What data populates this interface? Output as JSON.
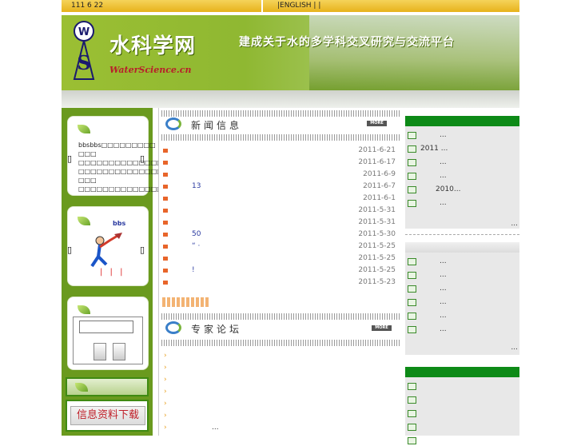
{
  "topbar": {
    "date": "111 6 22",
    "lang_links": "|ENGLISH |   |"
  },
  "banner": {
    "title": "水科学网",
    "subtitle": "WaterScience.cn",
    "slogan": "建成关于水的多学科交叉研究与交流平台",
    "logo_letters": {
      "top": "W",
      "bottom": "S"
    }
  },
  "left": {
    "box1_lines": [
      "bbsbbs□□□□□□□□□",
      "□□□",
      "□□□□□□□□□□□□□□",
      "□□□□□□□□□□□□□□",
      "□□□",
      "□□□□□□□□□□□□□□"
    ],
    "box2_title": "bbs",
    "box2_bars": "| | |",
    "download_label": "信息资料下载"
  },
  "news": {
    "title": "新闻信息",
    "more": "MORE",
    "items": [
      {
        "text": "",
        "date": "2011-6-21"
      },
      {
        "text": "",
        "date": "2011-6-17"
      },
      {
        "text": "",
        "date": "2011-6-9"
      },
      {
        "text": "13",
        "date": "2011-6-7"
      },
      {
        "text": "",
        "date": "2011-6-1"
      },
      {
        "text": "",
        "date": "2011-5-31"
      },
      {
        "text": "",
        "date": "2011-5-31"
      },
      {
        "text": "50",
        "date": "2011-5-30"
      },
      {
        "text": "“  ·",
        "date": "2011-5-25"
      },
      {
        "text": "",
        "date": "2011-5-25"
      },
      {
        "text": "!",
        "date": "2011-5-25"
      },
      {
        "text": "",
        "date": "2011-5-23"
      }
    ]
  },
  "forum": {
    "title": "专家论坛",
    "more": "MORE",
    "items": [
      "",
      "",
      "",
      "",
      "",
      "",
      "..."
    ]
  },
  "right": {
    "panel1_items": [
      "...",
      "2011     ...",
      "...",
      "...",
      "2010...",
      "..."
    ],
    "panel1_more": "...",
    "panel2_items": [
      "...",
      "...",
      "...",
      "...",
      "...",
      "..."
    ],
    "panel2_more": "...",
    "panel3_items": [
      "",
      "",
      "",
      "",
      ""
    ]
  },
  "colors": {
    "green_dark": "#0d8a17",
    "left_green": "#6a9a1e",
    "topbar_yellow": "#f0c63c",
    "news_arrow": "#e8652a"
  }
}
